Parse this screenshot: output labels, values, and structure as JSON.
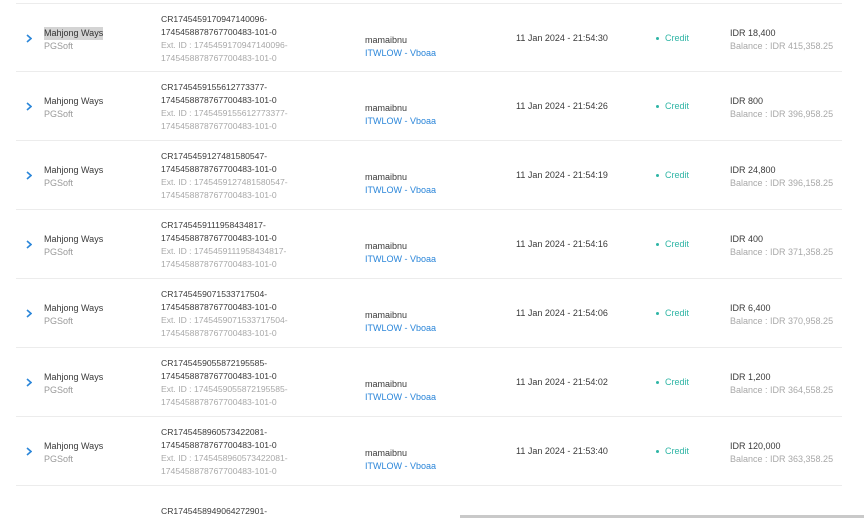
{
  "rows": [
    {
      "game": "Mahjong Ways",
      "provider": "PGSoft",
      "txn_id_1": "CR1745459170947140096-",
      "txn_id_2": "1745458878767700483-101-0",
      "ext_1": "Ext. ID : 1745459170947140096-",
      "ext_2": "1745458878767700483-101-0",
      "user": "mamaibnu",
      "agent": "ITWLOW - Vboaa",
      "date": "11 Jan 2024 - 21:54:30",
      "status": "Credit",
      "amount": "IDR 18,400",
      "balance": "Balance : IDR 415,358.25"
    },
    {
      "game": "Mahjong Ways",
      "provider": "PGSoft",
      "txn_id_1": "CR1745459155612773377-",
      "txn_id_2": "1745458878767700483-101-0",
      "ext_1": "Ext. ID : 1745459155612773377-",
      "ext_2": "1745458878767700483-101-0",
      "user": "mamaibnu",
      "agent": "ITWLOW - Vboaa",
      "date": "11 Jan 2024 - 21:54:26",
      "status": "Credit",
      "amount": "IDR 800",
      "balance": "Balance : IDR 396,958.25"
    },
    {
      "game": "Mahjong Ways",
      "provider": "PGSoft",
      "txn_id_1": "CR1745459127481580547-",
      "txn_id_2": "1745458878767700483-101-0",
      "ext_1": "Ext. ID : 1745459127481580547-",
      "ext_2": "1745458878767700483-101-0",
      "user": "mamaibnu",
      "agent": "ITWLOW - Vboaa",
      "date": "11 Jan 2024 - 21:54:19",
      "status": "Credit",
      "amount": "IDR 24,800",
      "balance": "Balance : IDR 396,158.25"
    },
    {
      "game": "Mahjong Ways",
      "provider": "PGSoft",
      "txn_id_1": "CR1745459111958434817-",
      "txn_id_2": "1745458878767700483-101-0",
      "ext_1": "Ext. ID : 1745459111958434817-",
      "ext_2": "1745458878767700483-101-0",
      "user": "mamaibnu",
      "agent": "ITWLOW - Vboaa",
      "date": "11 Jan 2024 - 21:54:16",
      "status": "Credit",
      "amount": "IDR 400",
      "balance": "Balance : IDR 371,358.25"
    },
    {
      "game": "Mahjong Ways",
      "provider": "PGSoft",
      "txn_id_1": "CR1745459071533717504-",
      "txn_id_2": "1745458878767700483-101-0",
      "ext_1": "Ext. ID : 1745459071533717504-",
      "ext_2": "1745458878767700483-101-0",
      "user": "mamaibnu",
      "agent": "ITWLOW - Vboaa",
      "date": "11 Jan 2024 - 21:54:06",
      "status": "Credit",
      "amount": "IDR 6,400",
      "balance": "Balance : IDR 370,958.25"
    },
    {
      "game": "Mahjong Ways",
      "provider": "PGSoft",
      "txn_id_1": "CR1745459055872195585-",
      "txn_id_2": "1745458878767700483-101-0",
      "ext_1": "Ext. ID : 1745459055872195585-",
      "ext_2": "1745458878767700483-101-0",
      "user": "mamaibnu",
      "agent": "ITWLOW - Vboaa",
      "date": "11 Jan 2024 - 21:54:02",
      "status": "Credit",
      "amount": "IDR 1,200",
      "balance": "Balance : IDR 364,558.25"
    },
    {
      "game": "Mahjong Ways",
      "provider": "PGSoft",
      "txn_id_1": "CR1745458960573422081-",
      "txn_id_2": "1745458878767700483-101-0",
      "ext_1": "Ext. ID : 1745458960573422081-",
      "ext_2": "1745458878767700483-101-0",
      "user": "mamaibnu",
      "agent": "ITWLOW - Vboaa",
      "date": "11 Jan 2024 - 21:53:40",
      "status": "Credit",
      "amount": "IDR 120,000",
      "balance": "Balance : IDR 363,358.25"
    }
  ],
  "partial_row": {
    "txn_id_1": "CR1745458949064272901-"
  },
  "colors": {
    "link": "#2b86d9",
    "credit": "#2fb5a5",
    "muted": "#a8a8a8"
  },
  "icons": {
    "expand": "chevron-right-icon"
  }
}
